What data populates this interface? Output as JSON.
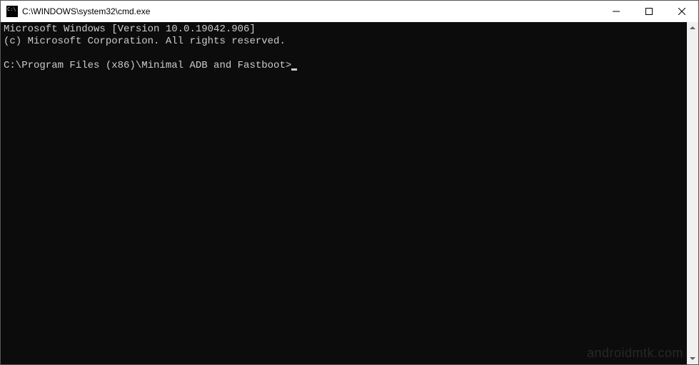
{
  "window": {
    "title": "C:\\WINDOWS\\system32\\cmd.exe"
  },
  "terminal": {
    "line1": "Microsoft Windows [Version 10.0.19042.906]",
    "line2": "(c) Microsoft Corporation. All rights reserved.",
    "blank": "",
    "prompt": "C:\\Program Files (x86)\\Minimal ADB and Fastboot>"
  },
  "watermark": "androidmtk.com"
}
